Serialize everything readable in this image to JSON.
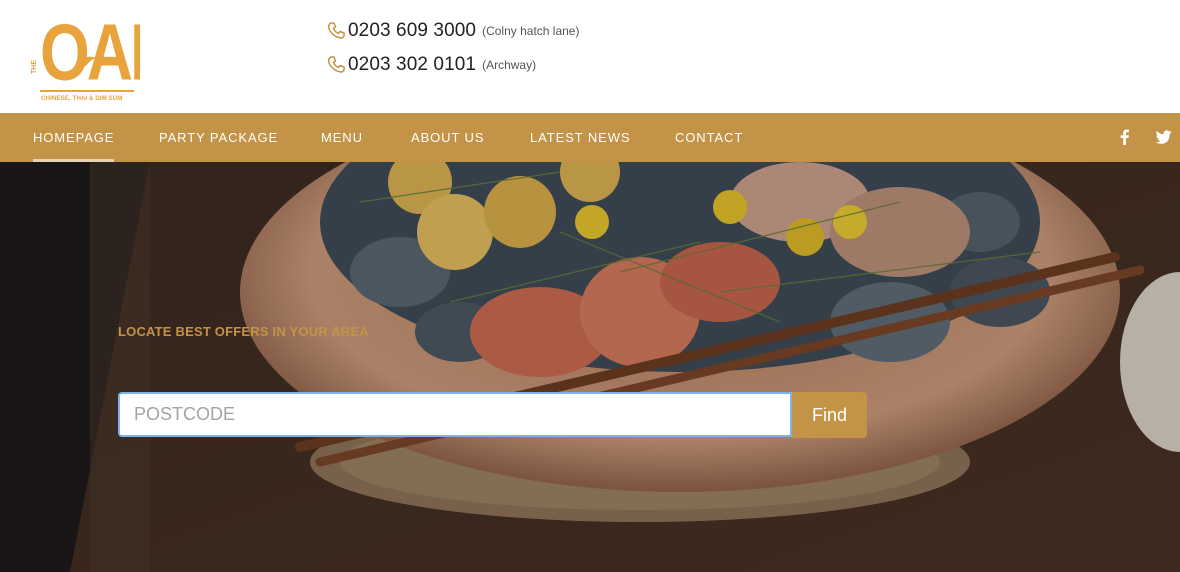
{
  "brand": {
    "the_label": "THE",
    "name": "OAK",
    "subtitle": "CHINESE, THAI & DIM SUM",
    "color": "#c39347"
  },
  "phones": [
    {
      "icon": "phone-icon",
      "number": "0203 609 3000",
      "location": "(Colny hatch lane)"
    },
    {
      "icon": "phone-icon",
      "number": "0203 302 0101",
      "location": "(Archway)"
    }
  ],
  "nav": {
    "items": [
      {
        "label": "HOMEPAGE",
        "active": true
      },
      {
        "label": "PARTY PACKAGE",
        "active": false
      },
      {
        "label": "MENU",
        "active": false
      },
      {
        "label": "ABOUT US",
        "active": false
      },
      {
        "label": "LATEST NEWS",
        "active": false
      },
      {
        "label": "CONTACT",
        "active": false
      }
    ],
    "social": [
      "facebook-icon",
      "twitter-icon"
    ],
    "background": "#c39347"
  },
  "hero": {
    "tagline": "LOCATE BEST OFFERS IN YOUR AREA",
    "search": {
      "placeholder": "POSTCODE",
      "value": ""
    },
    "find_label": "Find"
  }
}
